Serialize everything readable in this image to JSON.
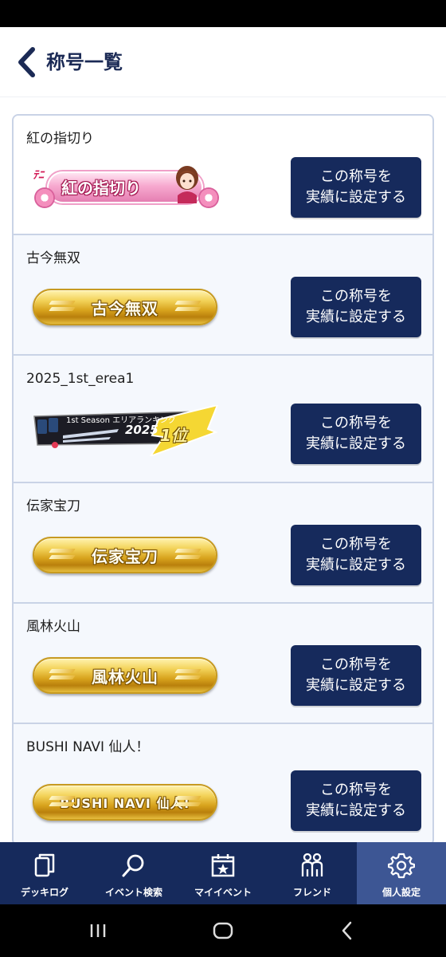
{
  "header": {
    "title": "称号一覧",
    "back_icon": "chevron-left-icon"
  },
  "titles": [
    {
      "name": "紅の指切り",
      "badge_text": "紅の指切り",
      "badge_tag": "ﾃﾆ",
      "badge_style": "pink",
      "button_label": "この称号を\n実績に設定する"
    },
    {
      "name": "古今無双",
      "badge_text": "古今無双",
      "badge_style": "gold",
      "button_label": "この称号を\n実績に設定する"
    },
    {
      "name": "2025_1st_erea1",
      "badge_season": "1st Season エリアランキング",
      "badge_year": "2025",
      "badge_rank": "1位",
      "badge_style": "ranking",
      "button_label": "この称号を\n実績に設定する"
    },
    {
      "name": "伝家宝刀",
      "badge_text": "伝家宝刀",
      "badge_style": "gold",
      "button_label": "この称号を\n実績に設定する"
    },
    {
      "name": "風林火山",
      "badge_text": "風林火山",
      "badge_style": "gold",
      "button_label": "この称号を\n実績に設定する"
    },
    {
      "name": "BUSHI NAVI 仙人！",
      "badge_text": "BUSHI NAVI 仙人!",
      "badge_style": "gold",
      "button_label": "この称号を\n実績に設定する"
    }
  ],
  "bottom_nav": [
    {
      "label": "デッキログ",
      "icon": "cards-icon",
      "active": false
    },
    {
      "label": "イベント検索",
      "icon": "search-icon",
      "active": false
    },
    {
      "label": "マイイベント",
      "icon": "calendar-star-icon",
      "active": false
    },
    {
      "label": "フレンド",
      "icon": "friends-icon",
      "active": false
    },
    {
      "label": "個人設定",
      "icon": "gear-icon",
      "active": true
    }
  ],
  "colors": {
    "primary": "#162a5c",
    "active_tab": "#3d5694",
    "border": "#c9d3e6"
  }
}
